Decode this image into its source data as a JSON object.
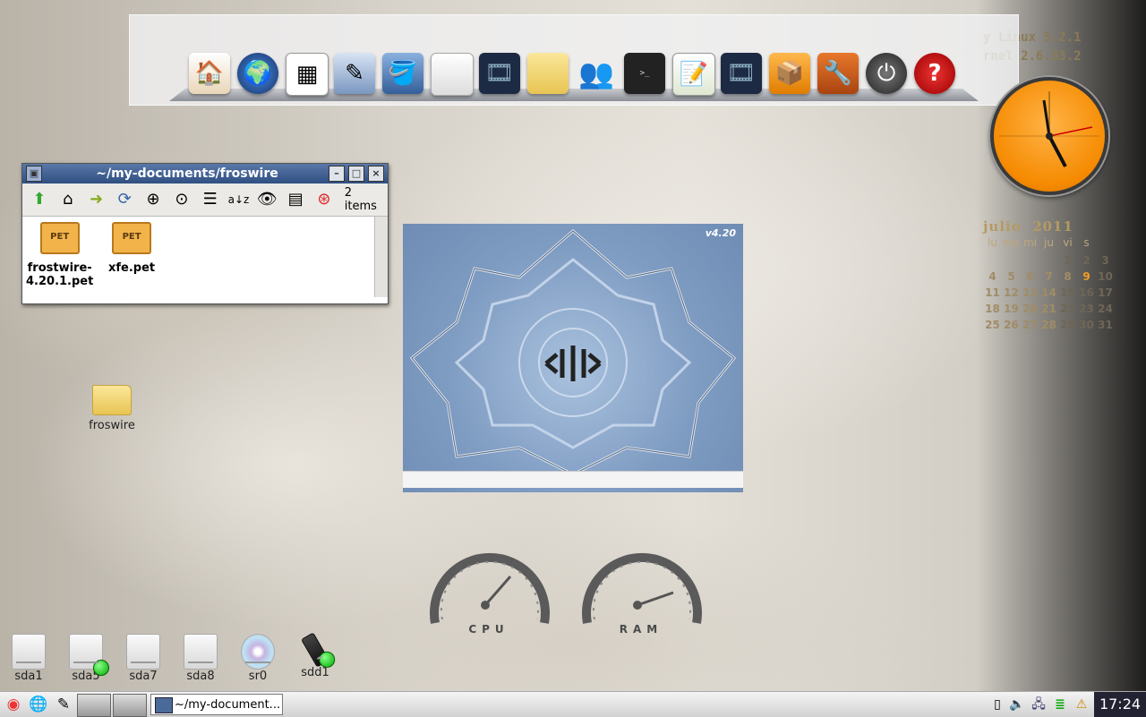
{
  "system_info": {
    "line1": "y Linux 5.2.1",
    "line2": "rnel 2.6.33.2"
  },
  "dock": {
    "items": [
      {
        "name": "home",
        "icon": "house-icon"
      },
      {
        "name": "browser",
        "icon": "globe-icon"
      },
      {
        "name": "spreadsheet",
        "icon": "spreadsheet-icon"
      },
      {
        "name": "word-processor",
        "icon": "writer-icon"
      },
      {
        "name": "paint",
        "icon": "paint-bucket-icon"
      },
      {
        "name": "drive",
        "icon": "drive-icon"
      },
      {
        "name": "video",
        "icon": "film-icon"
      },
      {
        "name": "files",
        "icon": "folder-icon"
      },
      {
        "name": "users",
        "icon": "users-icon"
      },
      {
        "name": "terminal",
        "icon": "terminal-icon"
      },
      {
        "name": "editor",
        "icon": "text-editor-icon"
      },
      {
        "name": "media",
        "icon": "film-icon"
      },
      {
        "name": "packages",
        "icon": "package-box-icon"
      },
      {
        "name": "setup",
        "icon": "toolbox-icon"
      },
      {
        "name": "shutdown",
        "icon": "power-icon"
      },
      {
        "name": "help",
        "icon": "help-icon"
      }
    ]
  },
  "calendar": {
    "month": "julio",
    "year": "2011",
    "weekdays": [
      "lu",
      "ma",
      "mi",
      "ju",
      "vi",
      "s",
      ""
    ],
    "today": 9
  },
  "file_window": {
    "title": "~/my-documents/froswire",
    "item_count": "2 items",
    "files": [
      {
        "name_line1": "frostwire-",
        "name_line2": "4.20.1.pet"
      },
      {
        "name_line1": "xfe.pet",
        "name_line2": ""
      }
    ],
    "pet_label": "PET"
  },
  "splash": {
    "version": "v4.20"
  },
  "gauges": {
    "cpu_label": "CPU",
    "ram_label": "RAM"
  },
  "desktop": {
    "folder_label": "froswire",
    "drives": [
      {
        "label": "sda1",
        "mounted": false
      },
      {
        "label": "sda5",
        "mounted": true
      },
      {
        "label": "sda7",
        "mounted": false
      },
      {
        "label": "sda8",
        "mounted": false
      },
      {
        "label": "sr0",
        "mounted": false
      },
      {
        "label": "sdd1",
        "mounted": true
      }
    ]
  },
  "taskbar": {
    "task_label": "~/my-document...",
    "clock": "17:24"
  }
}
